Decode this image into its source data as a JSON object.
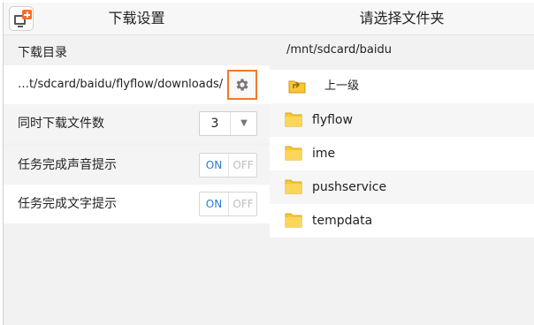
{
  "left_panel": {
    "title": "下载设置",
    "download_dir_label": "下载目录",
    "download_path": "…t/sdcard/baidu/flyflow/downloads/",
    "concurrent_label": "同时下载文件数",
    "concurrent_value": "3",
    "sound_label": "任务完成声音提示",
    "text_label": "任务完成文字提示",
    "toggle_on": "ON",
    "toggle_off": "OFF"
  },
  "right_panel": {
    "title": "请选择文件夹",
    "current_path": "/mnt/sdcard/baidu",
    "up_label": "上一级",
    "folders": [
      "flyflow",
      "ime",
      "pushservice",
      "tempdata"
    ]
  },
  "colors": {
    "accent_orange": "#ee7b2c",
    "toggle_on_blue": "#2b7bd6",
    "folder_yellow": "#f9c733"
  },
  "icons": {
    "app": "download-app-icon",
    "settings": "gear-icon",
    "up": "folder-up-icon",
    "folder": "folder-icon",
    "dropdown": "chevron-down-icon"
  }
}
